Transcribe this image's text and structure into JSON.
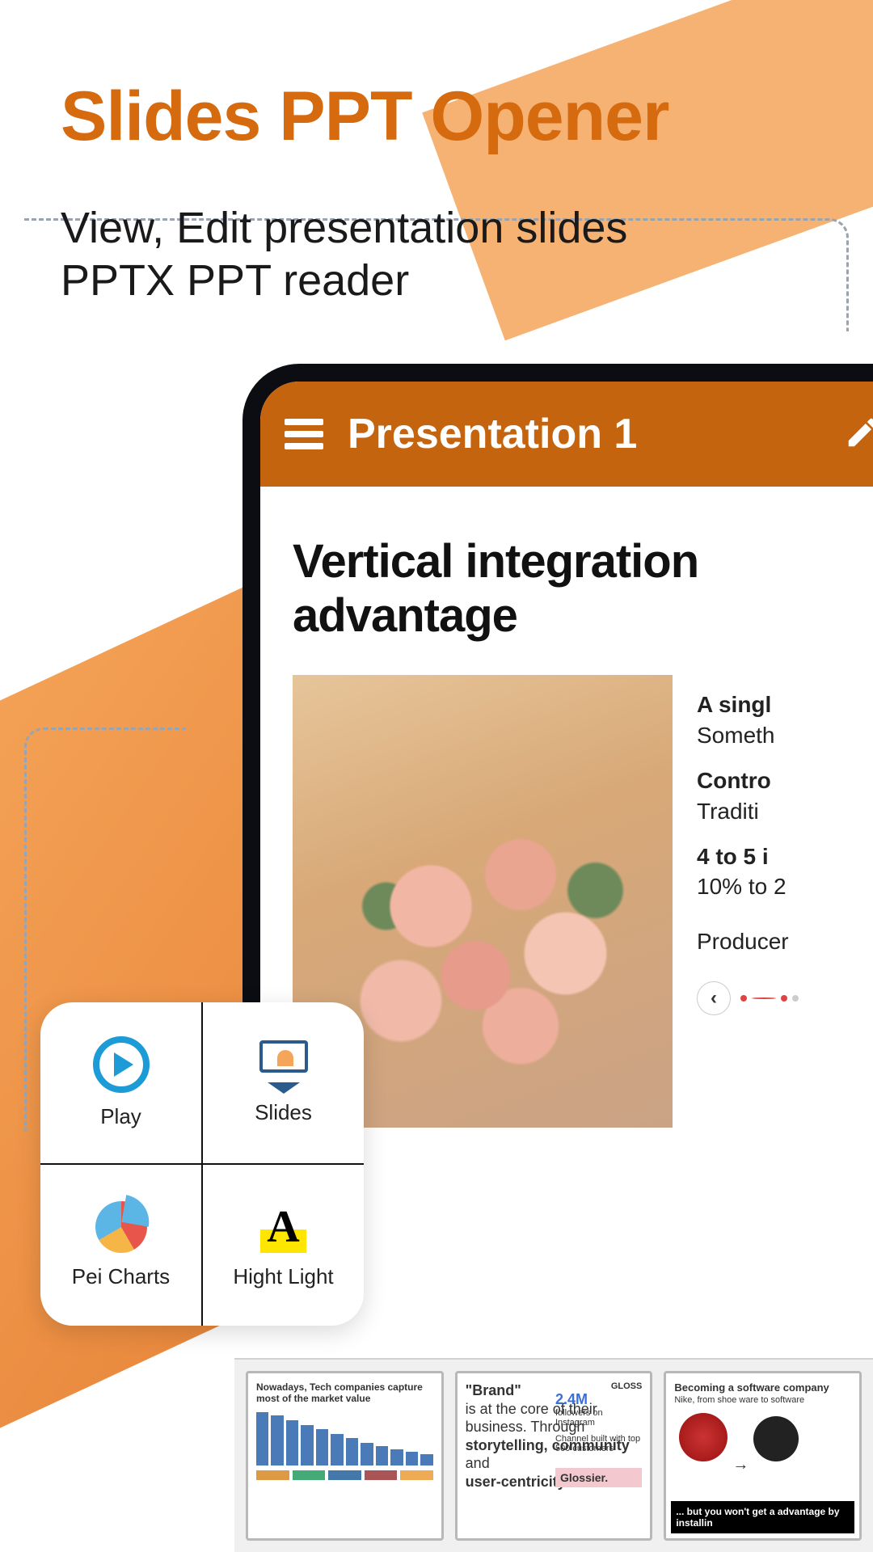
{
  "colors": {
    "accent": "#d66a0f",
    "header": "#c5640f"
  },
  "headline": "Slides PPT Opener",
  "subhead_line1": "View, Edit presentation slides",
  "subhead_line2": "PPTX PPT reader",
  "phone": {
    "title": "Presentation 1",
    "slide_title": "Vertical integration advantage",
    "side": {
      "h1": "A singl",
      "l1": "Someth",
      "h2": "Contro",
      "l2": "Traditi",
      "h3": "4 to 5 i",
      "l3": "10% to 2",
      "producer": "Producer"
    }
  },
  "features": [
    {
      "label": "Play",
      "icon": "play-icon"
    },
    {
      "label": "Slides",
      "icon": "slides-icon"
    },
    {
      "label": "Pei Charts",
      "icon": "pie-chart-icon"
    },
    {
      "label": "Hight Light",
      "icon": "highlight-icon"
    }
  ],
  "thumbnails": {
    "t1": {
      "title": "Nowadays, Tech companies capture most of the market value"
    },
    "t2": {
      "brand_word": "\"Brand\"",
      "body1": "is at the core of their business. Through",
      "body_bold": "storytelling, community",
      "body2": "and",
      "body_bold2": "user-centricity",
      "gloss": "GLOSS",
      "stat": "2.4M",
      "stat_sub": "followers on Instagram",
      "channel": "Channel built with top 500 customers",
      "glossier": "Glossier."
    },
    "t3": {
      "title": "Becoming a software company",
      "sub": "Nike, from shoe ware to software",
      "footer": "... but you won't get a advantage by installin"
    }
  }
}
